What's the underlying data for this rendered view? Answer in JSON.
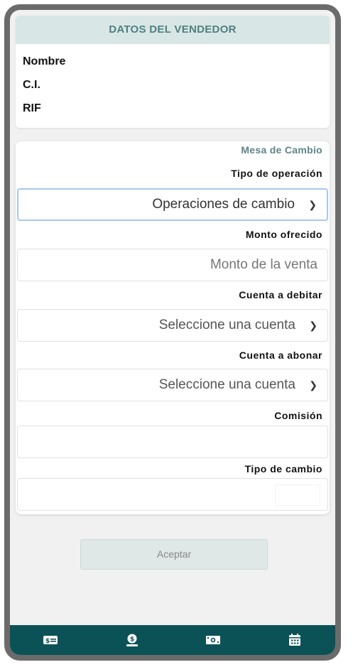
{
  "seller": {
    "header": "DATOS DEL VENDEDOR",
    "fields": [
      "Nombre",
      "C.I.",
      "RIF"
    ]
  },
  "form": {
    "title": "Mesa de Cambio",
    "operation_type": {
      "label": "Tipo de operación",
      "value": "Operaciones de cambio"
    },
    "amount": {
      "label": "Monto ofrecido",
      "placeholder": "Monto de la venta"
    },
    "debit_account": {
      "label": "Cuenta a debitar",
      "value": "Seleccione una cuenta"
    },
    "credit_account": {
      "label": "Cuenta a abonar",
      "value": "Seleccione una cuenta"
    },
    "commission": {
      "label": "Comisión",
      "value": ""
    },
    "exchange_rate": {
      "label": "Tipo de cambio",
      "value": ""
    }
  },
  "actions": {
    "accept_label": "Aceptar"
  },
  "bottom_nav": {
    "items": [
      "bill-icon",
      "coin-hand-icon",
      "cash-icon",
      "calendar-icon"
    ]
  },
  "colors": {
    "header_bg": "#d9e6e6",
    "header_text": "#4f8082",
    "nav_bg": "#0b5257",
    "focus_border": "#a6c8f2"
  }
}
